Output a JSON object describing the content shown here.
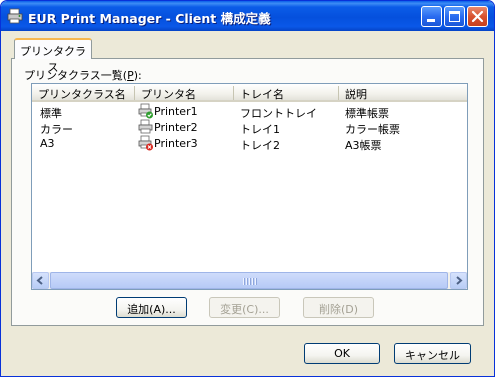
{
  "window": {
    "title": "EUR Print Manager - Client 構成定義",
    "colors": {
      "titlebar": "#0550dd",
      "face": "#ece9d8",
      "tab_highlight": "#f7b84e"
    }
  },
  "tab": {
    "label": "プリンタクラス"
  },
  "list": {
    "label_prefix": "プリンタクラス一覧(",
    "label_key": "P",
    "label_suffix": "):",
    "columns": [
      "プリンタクラス名",
      "プリンタ名",
      "トレイ名",
      "説明"
    ],
    "rows": [
      {
        "class_name": "標準",
        "printer": "Printer1",
        "tray": "フロントトレイ",
        "description": "標準帳票",
        "printer_status": "ok",
        "status_icon": "printer-ok-icon"
      },
      {
        "class_name": "カラー",
        "printer": "Printer2",
        "tray": "トレイ1",
        "description": "カラー帳票",
        "printer_status": "normal",
        "status_icon": "printer-icon"
      },
      {
        "class_name": "A3",
        "printer": "Printer3",
        "tray": "トレイ2",
        "description": "A3帳票",
        "printer_status": "error",
        "status_icon": "printer-error-icon"
      }
    ]
  },
  "buttons": {
    "add": "追加(A)...",
    "change": "変更(C)...",
    "delete": "削除(D)",
    "ok": "OK",
    "cancel": "キャンセル"
  }
}
